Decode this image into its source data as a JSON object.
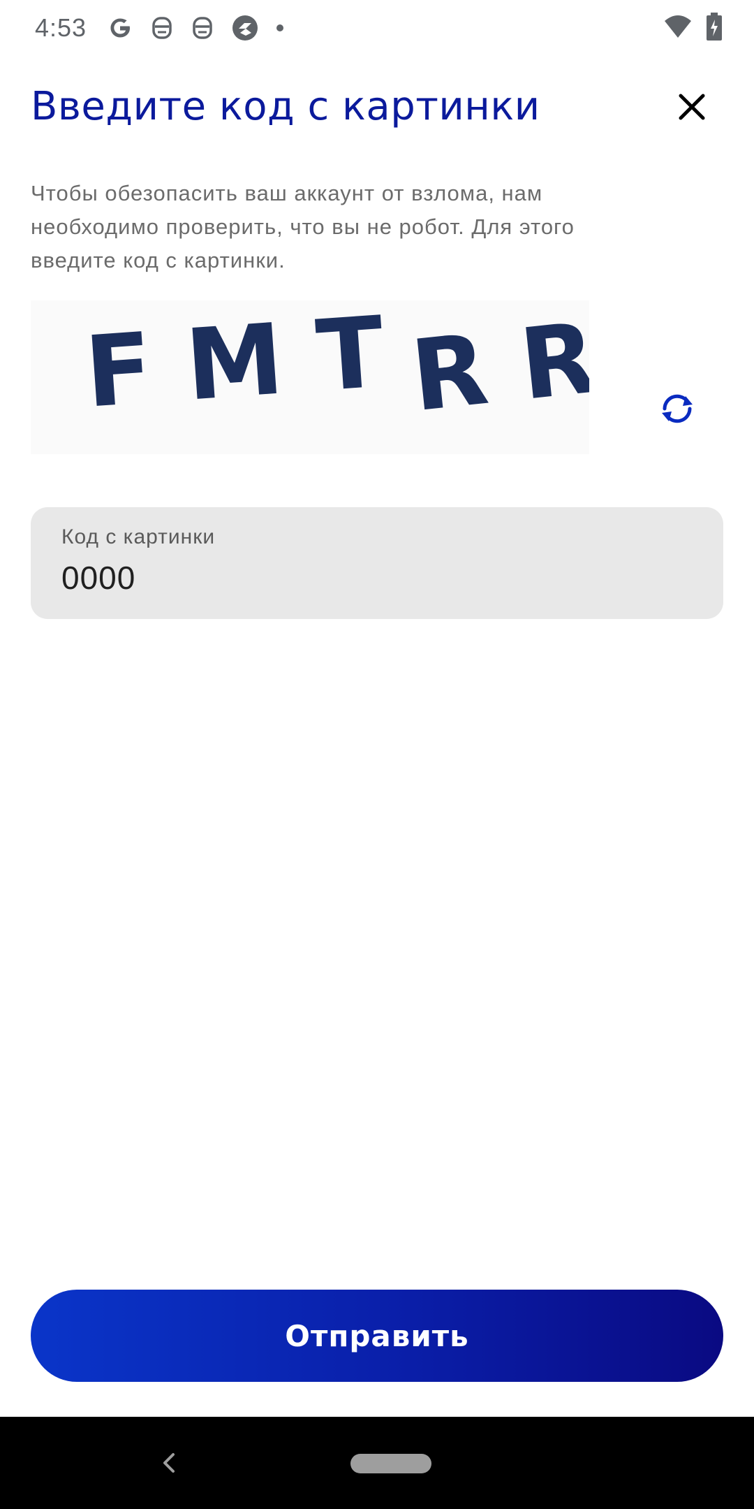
{
  "status_bar": {
    "time": "4:53",
    "icons_left": [
      "google-icon",
      "face-icon",
      "face-icon",
      "shield-app-icon",
      "dot-icon"
    ],
    "icons_right": [
      "wifi-icon",
      "battery-charging-icon"
    ]
  },
  "dialog": {
    "title": "Введите код с картинки",
    "description_lines": [
      "Чтобы обезопасить ваш аккаунт от взлома, нам",
      "необходимо проверить, что вы не робот. Для этого",
      "введите код с картинки."
    ],
    "captcha": {
      "text_group1": "F M T",
      "text_group2": "R R"
    },
    "input": {
      "label": "Код с картинки",
      "value": "0000"
    },
    "submit_label": "Отправить"
  },
  "colors": {
    "title": "#0b1a9c",
    "accent": "#0a2bc0",
    "button_gradient_start": "#0a35c9",
    "button_gradient_end": "#0a0a82",
    "captcha_ink": "#1c2f5c"
  }
}
